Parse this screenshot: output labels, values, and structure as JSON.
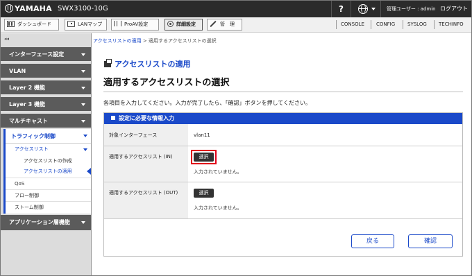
{
  "topbar": {
    "brand": "YAMAHA",
    "model": "SWX3100-10G",
    "help": "?",
    "user": "管理ユーザー : admin",
    "logout": "ログアウト"
  },
  "menu": {
    "tabs": [
      {
        "label": "ダッシュボード",
        "icon": "dashboard-icon"
      },
      {
        "label": "LANマップ",
        "icon": "lan-map-icon"
      },
      {
        "label": "ProAV設定",
        "icon": "proav-icon"
      },
      {
        "label": "詳細設定",
        "icon": "gear-icon",
        "active": true
      },
      {
        "label": "管　理",
        "icon": "tools-icon"
      }
    ],
    "links": [
      "CONSOLE",
      "CONFIG",
      "SYSLOG",
      "TECHINFO"
    ]
  },
  "sidebar": {
    "collapse": "◂◂",
    "categories": [
      "インターフェース設定",
      "VLAN",
      "Layer 2 機能",
      "Layer 3 機能",
      "マルチキャスト"
    ],
    "open_category": "トラフィック制御",
    "open_sub": "アクセスリスト",
    "leaves": [
      "アクセスリストの作成",
      "アクセスリストの適用"
    ],
    "plain_items": [
      "QoS",
      "フロー制御",
      "ストーム制御"
    ],
    "last_category": "アプリケーション層機能"
  },
  "breadcrumb": {
    "link": "アクセスリストの適用",
    "sep": " > ",
    "current": "適用するアクセスリストの選択"
  },
  "main": {
    "section_title": "アクセスリストの適用",
    "page_title": "適用するアクセスリストの選択",
    "instruction": "各項目を入力してください。入力が完了したら、「確認」ボタンを押してください。",
    "panel_title": "設定に必要な情報入力",
    "rows": {
      "iface_label": "対象インターフェース",
      "iface_value": "vlan11",
      "in_label": "適用するアクセスリスト (IN)",
      "in_button": "選択",
      "in_note": "入力されていません。",
      "out_label": "適用するアクセスリスト (OUT)",
      "out_button": "選択",
      "out_note": "入力されていません。"
    },
    "back": "戻る",
    "confirm": "確認"
  },
  "colors": {
    "accent": "#1a49c9",
    "highlight": "#e1001a",
    "topbar": "#2b2b2b"
  }
}
